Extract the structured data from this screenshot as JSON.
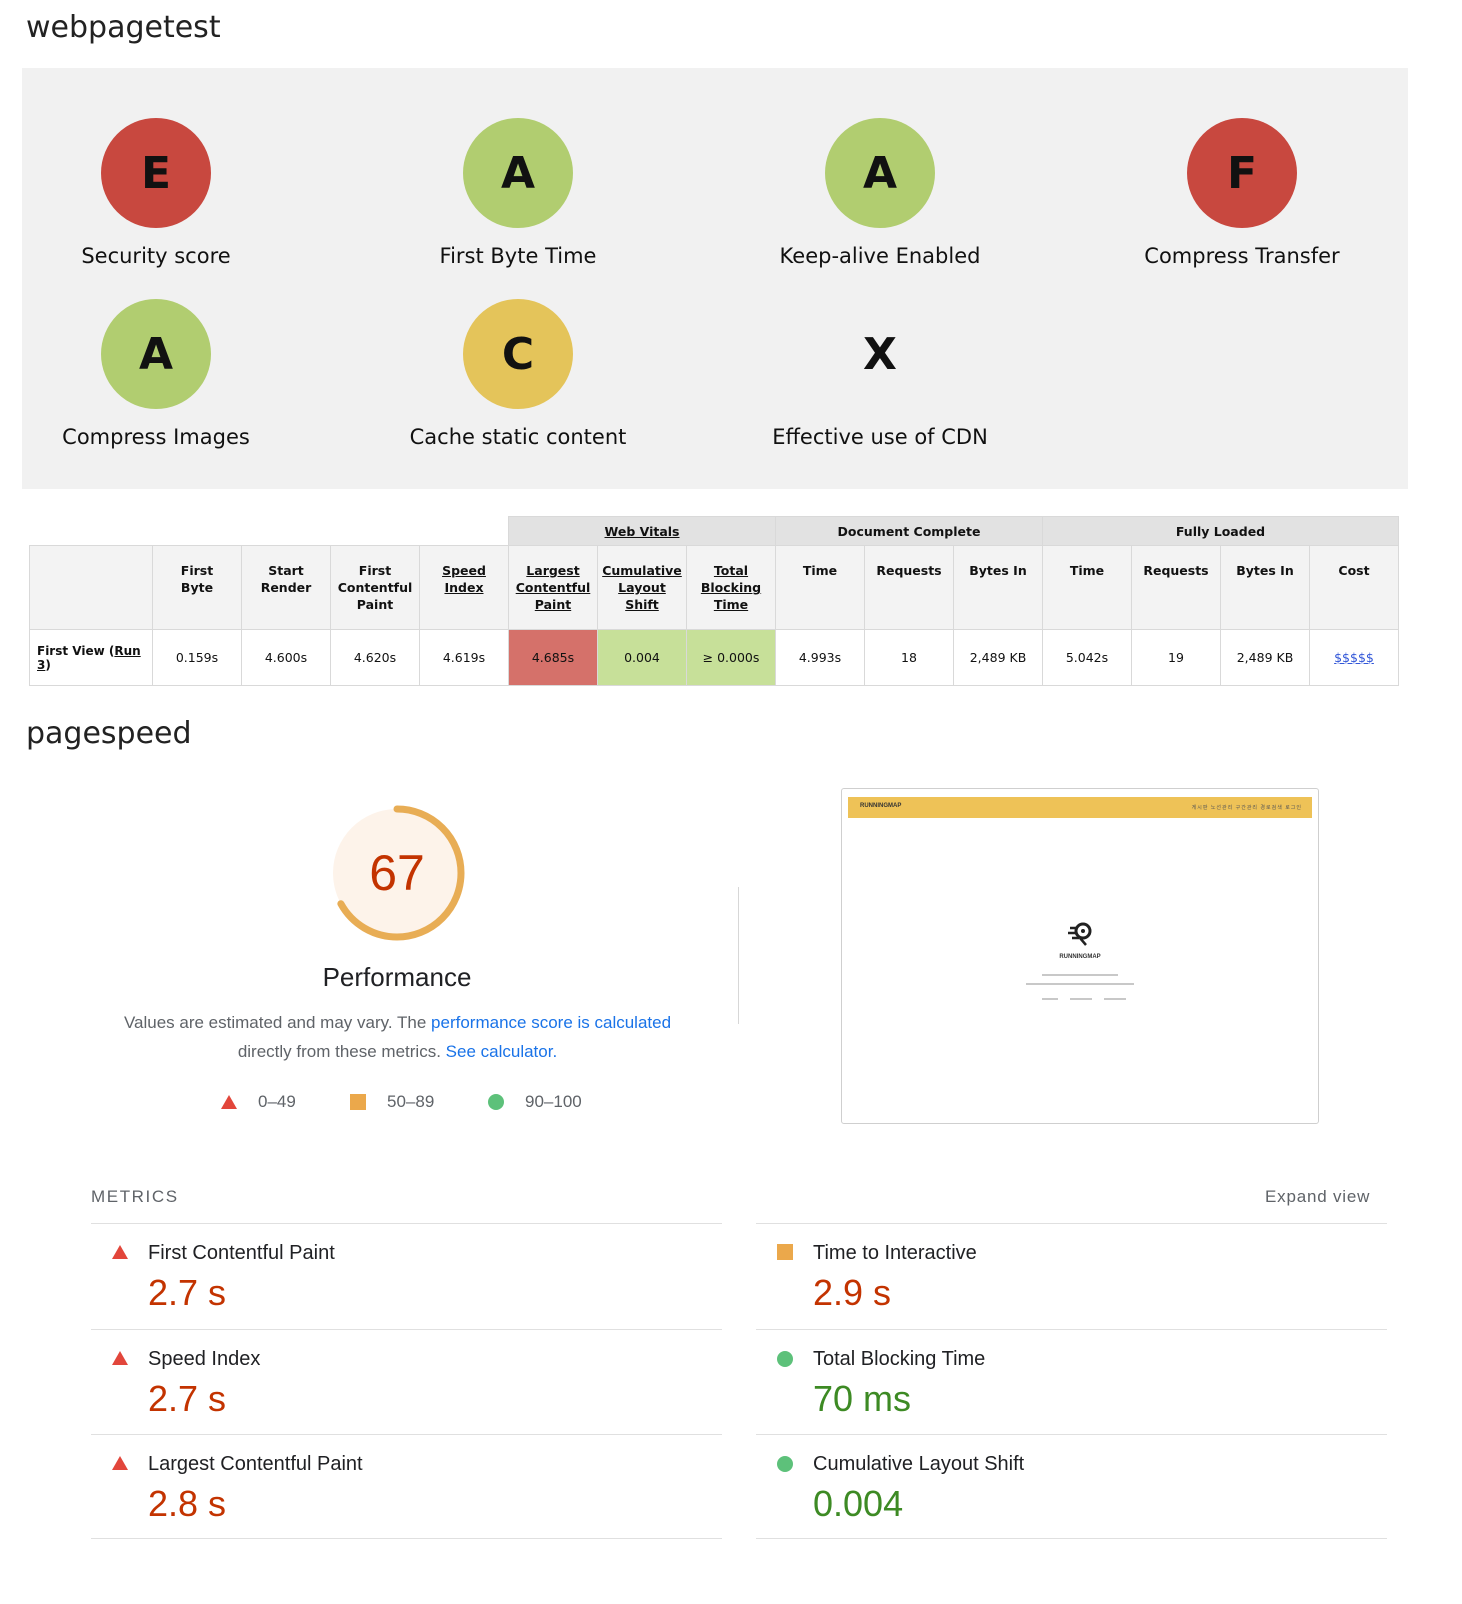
{
  "webpagetest": {
    "title": "webpagetest",
    "grades": [
      {
        "letter": "E",
        "label": "Security score",
        "color": "#c8483f"
      },
      {
        "letter": "A",
        "label": "First Byte Time",
        "color": "#b1cd70"
      },
      {
        "letter": "A",
        "label": "Keep-alive Enabled",
        "color": "#b1cd70"
      },
      {
        "letter": "F",
        "label": "Compress Transfer",
        "color": "#c8483f"
      },
      {
        "letter": "A",
        "label": "Compress Images",
        "color": "#b1cd70"
      },
      {
        "letter": "C",
        "label": "Cache static content",
        "color": "#e4c45a"
      },
      {
        "letter": "X",
        "label": "Effective use of CDN",
        "color": ""
      }
    ],
    "table": {
      "groups": {
        "web_vitals": "Web Vitals",
        "document_complete": "Document Complete",
        "fully_loaded": "Fully Loaded"
      },
      "headers": {
        "first_byte": [
          "First",
          "Byte"
        ],
        "start_render": [
          "Start",
          "Render"
        ],
        "first_contentful_paint": [
          "First",
          "Contentful",
          "Paint"
        ],
        "speed_index": [
          "Speed",
          "Index"
        ],
        "lcp": [
          "Largest",
          "Contentful",
          "Paint"
        ],
        "cls": [
          "Cumulative",
          "Layout",
          "Shift"
        ],
        "tbt": [
          "Total",
          "Blocking",
          "Time"
        ],
        "dc_time": "Time",
        "dc_requests": "Requests",
        "dc_bytes": "Bytes In",
        "fl_time": "Time",
        "fl_requests": "Requests",
        "fl_bytes": "Bytes In",
        "cost": "Cost"
      },
      "row": {
        "label": "First View (",
        "run_link": "Run 3",
        "label_end": ")",
        "first_byte": "0.159s",
        "start_render": "4.600s",
        "first_contentful_paint": "4.620s",
        "speed_index": "4.619s",
        "lcp": "4.685s",
        "cls": "0.004",
        "tbt": "≥ 0.000s",
        "dc_time": "4.993s",
        "dc_requests": "18",
        "dc_bytes": "2,489 KB",
        "fl_time": "5.042s",
        "fl_requests": "19",
        "fl_bytes": "2,489 KB",
        "cost": "$$$$$"
      }
    }
  },
  "pagespeed": {
    "title": "pagespeed",
    "score": "67",
    "score_fraction": 0.67,
    "category": "Performance",
    "desc_prefix": "Values are estimated and may vary. The ",
    "desc_link1": "performance score is calculated",
    "desc_middle": "directly from these metrics. ",
    "desc_link2": "See calculator.",
    "legend": {
      "fail": "0–49",
      "average": "50–89",
      "pass": "90–100"
    },
    "preview": {
      "logo_text": "RUNNINGMAP",
      "nav_text": "게시판   노선관리   구간관리   경로검색   로그인",
      "brand": "RUNNINGMAP"
    },
    "metrics_label": "METRICS",
    "expand_label": "Expand view",
    "metrics": {
      "fcp": {
        "name": "First Contentful Paint",
        "value": "2.7 s",
        "status": "fail"
      },
      "tti": {
        "name": "Time to Interactive",
        "value": "2.9 s",
        "status": "average"
      },
      "si": {
        "name": "Speed Index",
        "value": "2.7 s",
        "status": "fail"
      },
      "tbt": {
        "name": "Total Blocking Time",
        "value": "70 ms",
        "status": "pass"
      },
      "lcp": {
        "name": "Largest Contentful Paint",
        "value": "2.8 s",
        "status": "fail"
      },
      "cls": {
        "name": "Cumulative Layout Shift",
        "value": "0.004",
        "status": "pass"
      }
    },
    "colors": {
      "fail": "#e2463b",
      "average": "#eba84b",
      "pass": "#5dc17a",
      "gauge": "#e8ad55",
      "gauge_bg": "#fdf3ea"
    }
  }
}
